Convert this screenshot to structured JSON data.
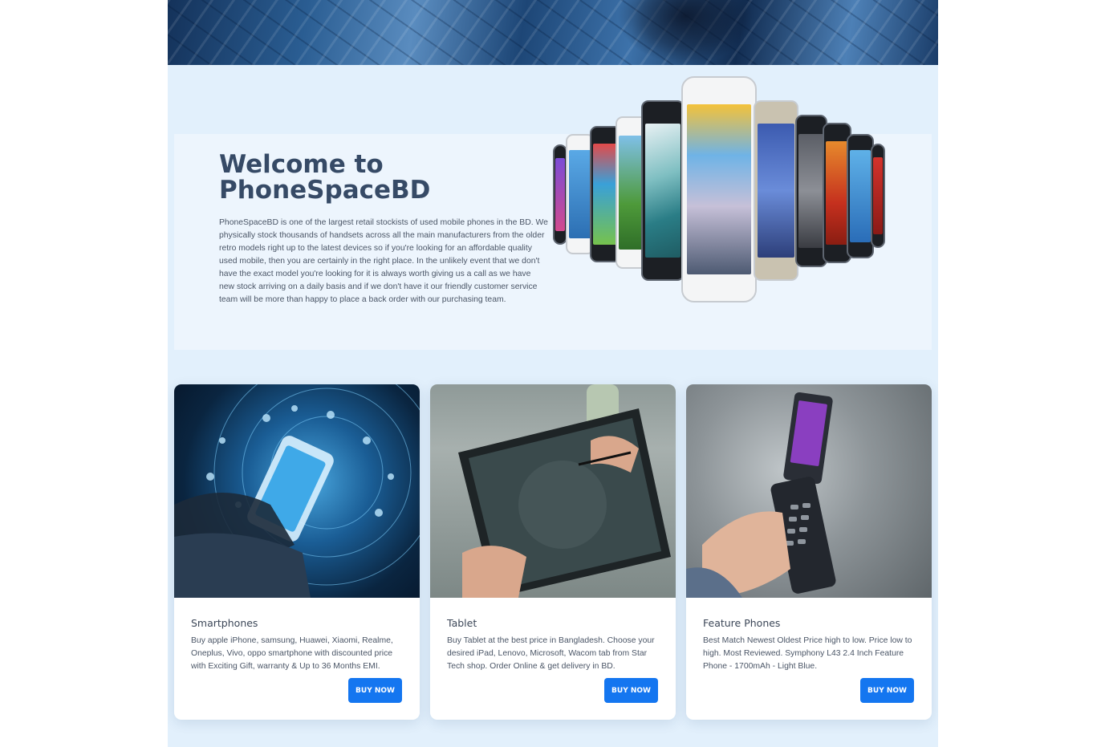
{
  "welcome": {
    "title": "Welcome to PhoneSpaceBD",
    "description": "PhoneSpaceBD is one of the largest retail stockists of used mobile phones in the BD. We physically stock thousands of handsets across all the main manufacturers from the older retro models right up to the latest devices so if you're looking for an affordable quality used mobile, then you are certainly in the right place. In the unlikely event that we don't have the exact model you're looking for it is always worth giving us a call as we have new stock arriving on a daily basis and if we don't have it our friendly customer service team will be more than happy to place a back order with our purchasing team."
  },
  "categories": [
    {
      "title": "Smartphones",
      "description": "Buy apple iPhone, samsung, Huawei, Xiaomi, Realme, Oneplus, Vivo, oppo smartphone with discounted price with Exciting Gift, warranty & Up to 36 Months EMI.",
      "button_label": "BUY NOW"
    },
    {
      "title": "Tablet",
      "description": "Buy Tablet at the best price in Bangladesh. Choose your desired iPad, Lenovo, Microsoft, Wacom tab from Star Tech shop. Order Online & get delivery in BD.",
      "button_label": "BUY NOW"
    },
    {
      "title": "Feature Phones",
      "description": "Best Match Newest Oldest Price high to low. Price low to high. Most Reviewed. Symphony L43 2.4 Inch Feature Phone - 1700mAh - Light Blue.",
      "button_label": "BUY NOW"
    }
  ],
  "colors": {
    "page_background": "#e2f0fc",
    "welcome_background": "#edf5fd",
    "heading": "#364a66",
    "button": "#1476f0"
  }
}
